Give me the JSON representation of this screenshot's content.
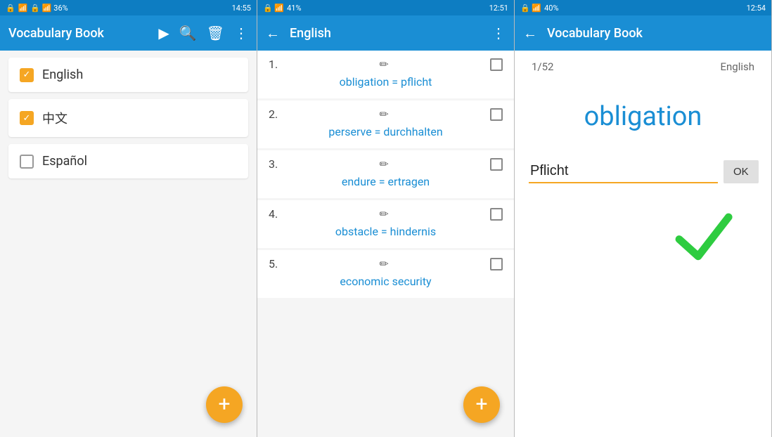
{
  "panel1": {
    "status": {
      "left": "🔒 📶 36%",
      "time": "14:55"
    },
    "title": "Vocabulary Book",
    "items": [
      {
        "label": "English",
        "checked": true
      },
      {
        "label": "中文",
        "checked": true
      },
      {
        "label": "Español",
        "checked": false
      }
    ],
    "add_label": "+"
  },
  "panel2": {
    "status": {
      "left": "🔒 📶 41%",
      "time": "12:51"
    },
    "title": "English",
    "words": [
      {
        "num": "1.",
        "pair": "obligation = pflicht"
      },
      {
        "num": "2.",
        "pair": "perserve = durchhalten"
      },
      {
        "num": "3.",
        "pair": "endure = ertragen"
      },
      {
        "num": "4.",
        "pair": "obstacle = hindernis"
      },
      {
        "num": "5.",
        "pair": "economic security"
      }
    ],
    "add_label": "+"
  },
  "panel3": {
    "status": {
      "left": "🔒 📶 40%",
      "time": "12:54"
    },
    "title": "Vocabulary Book",
    "progress": "1/52",
    "language": "English",
    "question": "obligation",
    "answer_value": "Pflicht",
    "ok_label": "OK"
  },
  "icons": {
    "play": "▶",
    "search": "🔍",
    "trash": "🗑",
    "more_vert": "⋮",
    "back": "←",
    "pencil": "✏",
    "plus": "+"
  }
}
